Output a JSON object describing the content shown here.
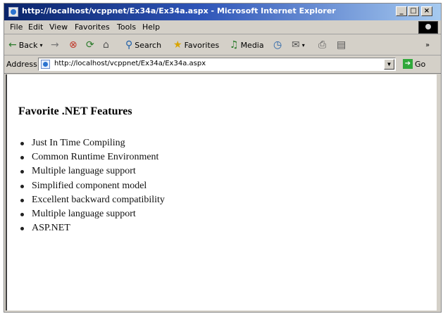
{
  "window": {
    "title": "http://localhost/vcppnet/Ex34a/Ex34a.aspx - Microsoft Internet Explorer",
    "controls": [
      "_",
      "□",
      "×"
    ]
  },
  "menubar": {
    "items": [
      "File",
      "Edit",
      "View",
      "Favorites",
      "Tools",
      "Help"
    ]
  },
  "toolbar": {
    "back_label": "Back",
    "forward_glyph": "→",
    "search_label": "Search",
    "favorites_label": "Favorites",
    "media_label": "Media"
  },
  "addressbar": {
    "label": "Address",
    "url": "http://localhost/vcppnet/Ex34a/Ex34a.aspx",
    "go_label": "Go"
  },
  "page": {
    "heading": "Favorite .NET Features",
    "features": [
      "Just In Time Compiling",
      "Common Runtime Environment",
      "Multiple language support",
      "Simplified component model",
      "Excellent backward  compatibility",
      "Multiple language support",
      "ASP.NET"
    ]
  }
}
